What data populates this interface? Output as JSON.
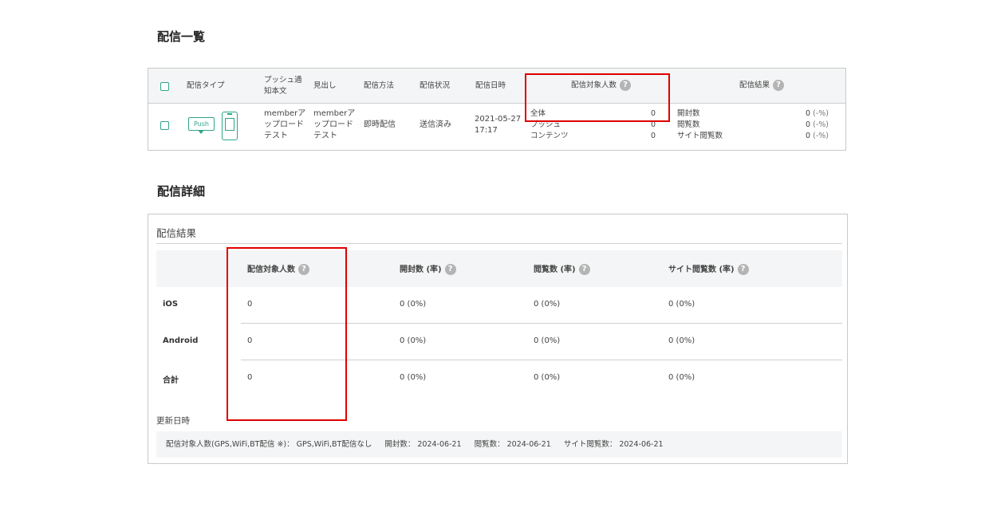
{
  "list_section": {
    "title": "配信一覧",
    "headers": {
      "type": "配信タイプ",
      "body": "プッシュ通知本文",
      "body_line1": "プッシュ通",
      "body_line2": "知本文",
      "heading": "見出し",
      "method": "配信方法",
      "status": "配信状況",
      "datetime": "配信日時",
      "target_count": "配信対象人数",
      "result": "配信結果"
    },
    "row": {
      "push_badge": "Push",
      "type_icons": [
        "push-badge-icon",
        "phone-content-icon"
      ],
      "body_lines": [
        "memberア",
        "ップロード",
        "テスト"
      ],
      "heading_lines": [
        "memberア",
        "ップロード",
        "テスト"
      ],
      "method": "即時配信",
      "status": "送信済み",
      "date": "2021-05-27",
      "time": "17:17",
      "targets": [
        {
          "label": "全体",
          "value": "0"
        },
        {
          "label": "プッシュ",
          "value": "0"
        },
        {
          "label": "コンテンツ",
          "value": "0"
        }
      ],
      "results": [
        {
          "label": "開封数",
          "value": "0",
          "rate": "(-%)"
        },
        {
          "label": "閲覧数",
          "value": "0",
          "rate": "(-%)"
        },
        {
          "label": "サイト閲覧数",
          "value": "0",
          "rate": "(-%)"
        }
      ]
    }
  },
  "detail_section": {
    "title": "配信詳細",
    "subtitle": "配信結果",
    "columns": [
      "配信対象人数",
      "開封数 (率)",
      "閲覧数 (率)",
      "サイト閲覧数 (率)"
    ],
    "rows": [
      {
        "label": "iOS",
        "target": "0",
        "open": "0 (0%)",
        "view": "0 (0%)",
        "site": "0 (0%)"
      },
      {
        "label": "Android",
        "target": "0",
        "open": "0 (0%)",
        "view": "0 (0%)",
        "site": "0 (0%)"
      },
      {
        "label": "合計",
        "target": "0",
        "open": "0 (0%)",
        "view": "0 (0%)",
        "site": "0 (0%)"
      }
    ],
    "updated_label": "更新日時",
    "updated_items": [
      "配信対象人数(GPS,WiFi,BT配信 ※)： GPS,WiFi,BT配信なし",
      "開封数： 2024-06-21",
      "閲覧数： 2024-06-21",
      "サイト閲覧数： 2024-06-21"
    ]
  },
  "help_glyph": "?",
  "colors": {
    "accent": "#2ea58a",
    "highlight": "#e00000",
    "header_bg": "#f4f5f6"
  }
}
